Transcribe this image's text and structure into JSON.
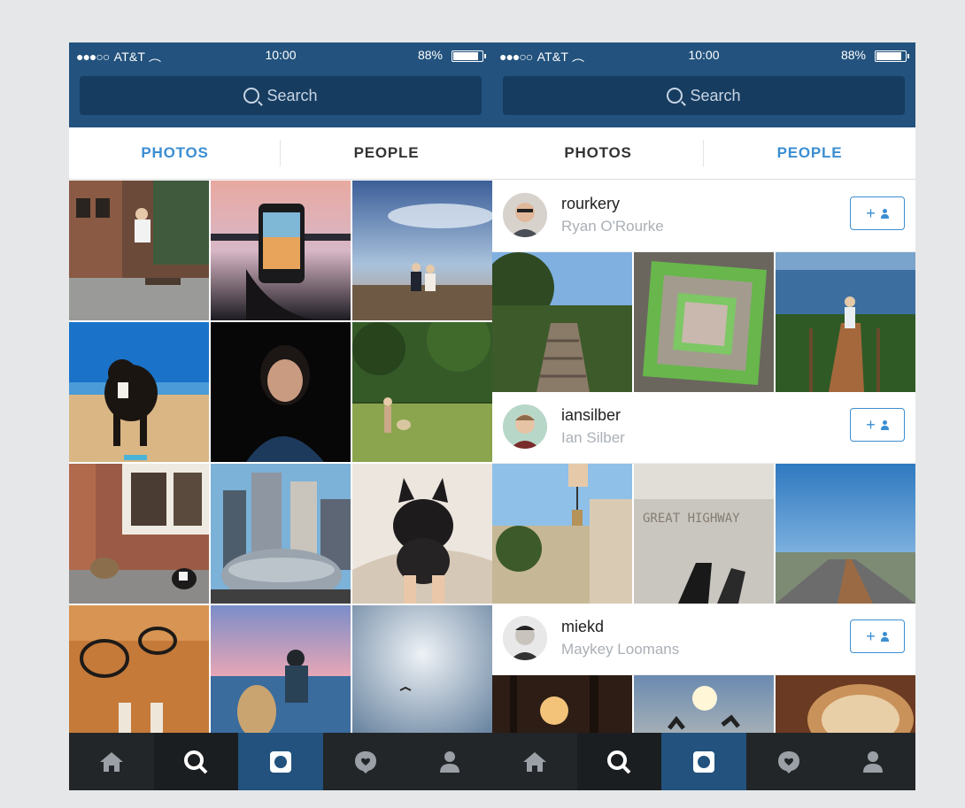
{
  "colors": {
    "header": "#22527d",
    "search_field": "#163c60",
    "accent": "#3b8ed2",
    "nav": "#222629",
    "nav_active": "#22527d",
    "background": "#e6e7e8"
  },
  "left_screen": {
    "status": {
      "carrier": "AT&T",
      "time": "10:00",
      "battery": "88%"
    },
    "search": {
      "placeholder": "Search"
    },
    "tabs": [
      {
        "label": "PHOTOS",
        "active": true
      },
      {
        "label": "PEOPLE",
        "active": false
      }
    ],
    "nav": [
      {
        "icon": "home-icon"
      },
      {
        "icon": "search-icon"
      },
      {
        "icon": "camera-icon",
        "active": true
      },
      {
        "icon": "activity-heart-icon"
      },
      {
        "icon": "profile-icon"
      }
    ]
  },
  "right_screen": {
    "status": {
      "carrier": "AT&T",
      "time": "10:00",
      "battery": "88%"
    },
    "search": {
      "placeholder": "Search"
    },
    "tabs": [
      {
        "label": "PHOTOS",
        "active": false
      },
      {
        "label": "PEOPLE",
        "active": true
      }
    ],
    "users": [
      {
        "username": "rourkery",
        "full_name": "Ryan O'Rourke",
        "follow": "+"
      },
      {
        "username": "iansilber",
        "full_name": "Ian Silber",
        "follow": "+"
      },
      {
        "username": "miekd",
        "full_name": "Maykey Loomans",
        "follow": "+"
      }
    ],
    "photo_text": "GREAT HIGHWAY"
  }
}
